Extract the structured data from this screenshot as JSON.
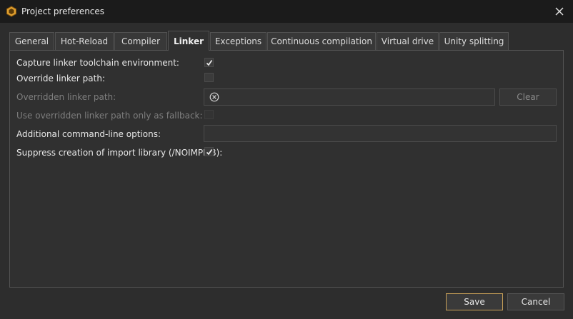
{
  "window": {
    "title": "Project preferences",
    "app_icon": "hexagon-app-icon",
    "close_icon": "close-icon"
  },
  "tabs": [
    {
      "label": "General",
      "active": false
    },
    {
      "label": "Hot-Reload",
      "active": false
    },
    {
      "label": "Compiler",
      "active": false
    },
    {
      "label": "Linker",
      "active": true
    },
    {
      "label": "Exceptions",
      "active": false
    },
    {
      "label": "Continuous compilation",
      "active": false
    },
    {
      "label": "Virtual drive",
      "active": false
    },
    {
      "label": "Unity splitting",
      "active": false
    }
  ],
  "linker": {
    "capture_env": {
      "label": "Capture linker toolchain environment:",
      "checked": true
    },
    "override_path": {
      "label": "Override linker path:",
      "checked": false
    },
    "overridden_path": {
      "label": "Overridden linker path:",
      "value": "",
      "clear_icon": "circle-x-icon",
      "clear_button": "Clear",
      "enabled": false
    },
    "fallback_only": {
      "label": "Use overridden linker path only as fallback:",
      "checked": false,
      "enabled": false
    },
    "additional_options": {
      "label": "Additional command-line options:",
      "value": ""
    },
    "suppress_implib": {
      "label": "Suppress creation of import library (/NOIMPLIB):",
      "checked": true
    }
  },
  "footer": {
    "save_label": "Save",
    "cancel_label": "Cancel"
  },
  "colors": {
    "background": "#2d2d2d",
    "titlebar": "#1b1b1b",
    "accent": "#c9a158",
    "icon_orange": "#e0a030"
  }
}
